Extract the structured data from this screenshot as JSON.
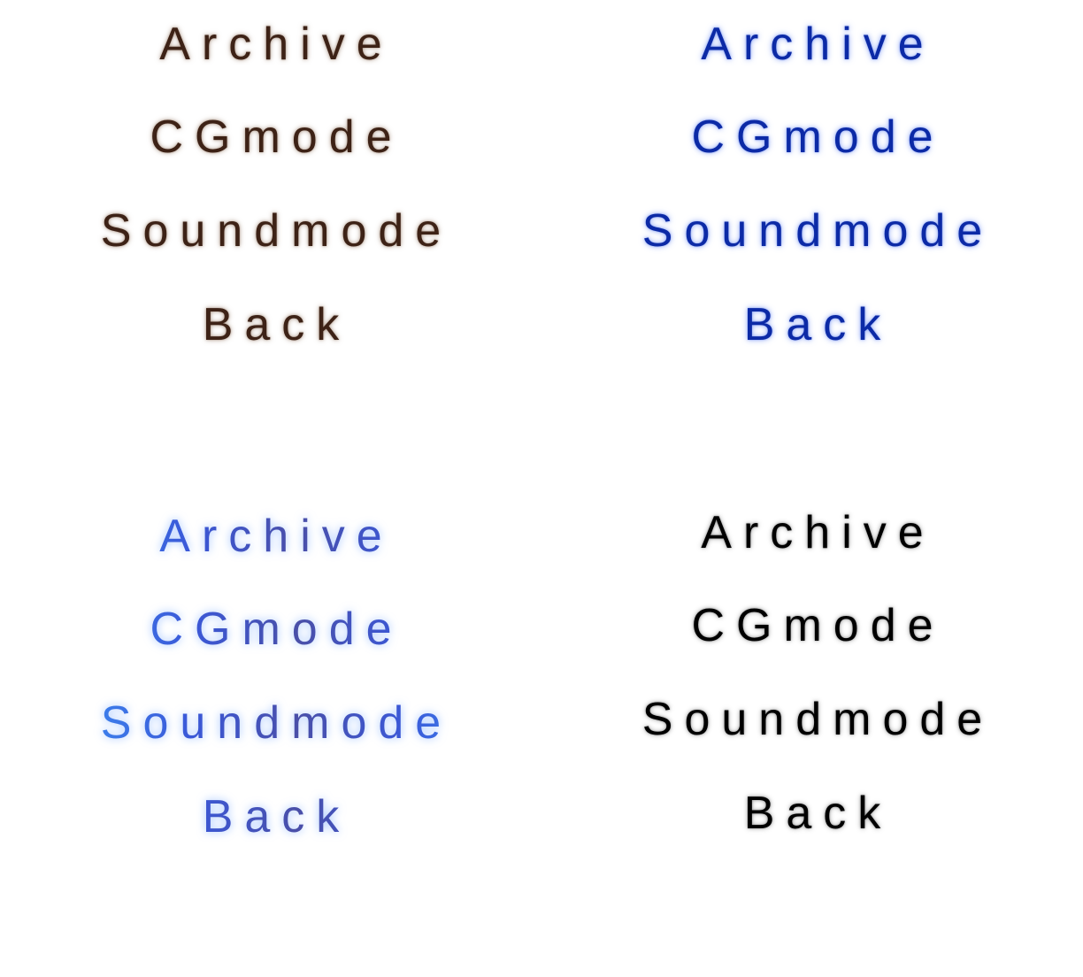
{
  "menus": [
    {
      "variant": "brown",
      "color": "#3d2216",
      "items": [
        "Archive",
        "CGmode",
        "Soundmode",
        "Back"
      ]
    },
    {
      "variant": "deep-blue",
      "color": "#0c2aa6",
      "items": [
        "Archive",
        "CGmode",
        "Soundmode",
        "Back"
      ]
    },
    {
      "variant": "gradient-blue",
      "color": "#3a6fe8",
      "items": [
        "Archive",
        "CGmode",
        "Soundmode",
        "Back"
      ]
    },
    {
      "variant": "black",
      "color": "#000000",
      "items": [
        "Archive",
        "CGmode",
        "Soundmode",
        "Back"
      ]
    }
  ]
}
